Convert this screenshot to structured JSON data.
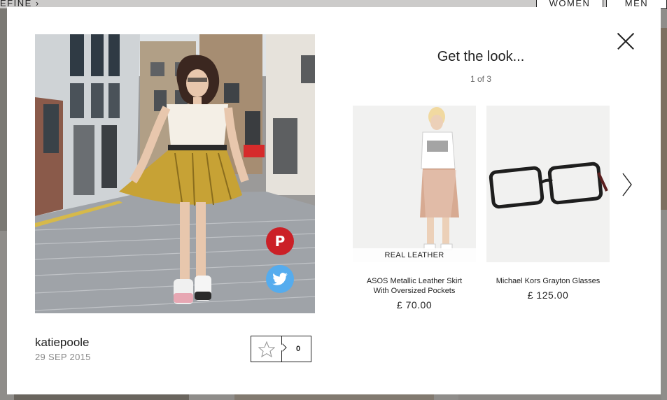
{
  "background": {
    "refine_label": "EFINE",
    "women_label": "WOMEN",
    "men_label": "MEN"
  },
  "modal": {
    "author": "katiepoole",
    "date": "29 SEP 2015",
    "like_count": "0",
    "look_title": "Get the look...",
    "look_pager": "1 of 3",
    "products": [
      {
        "badge": "REAL LEATHER",
        "name": "ASOS Metallic Leather Skirt With Oversized Pockets",
        "price": "£ 70.00"
      },
      {
        "badge": "",
        "name": "Michael Kors Grayton Glasses",
        "price": "£ 125.00"
      }
    ]
  },
  "colors": {
    "pinterest": "#cb2027",
    "twitter": "#55acee",
    "text": "#222222",
    "muted": "#888888"
  },
  "icons": [
    "close-icon",
    "pinterest-icon",
    "twitter-icon",
    "star-icon",
    "chevron-right-icon"
  ]
}
